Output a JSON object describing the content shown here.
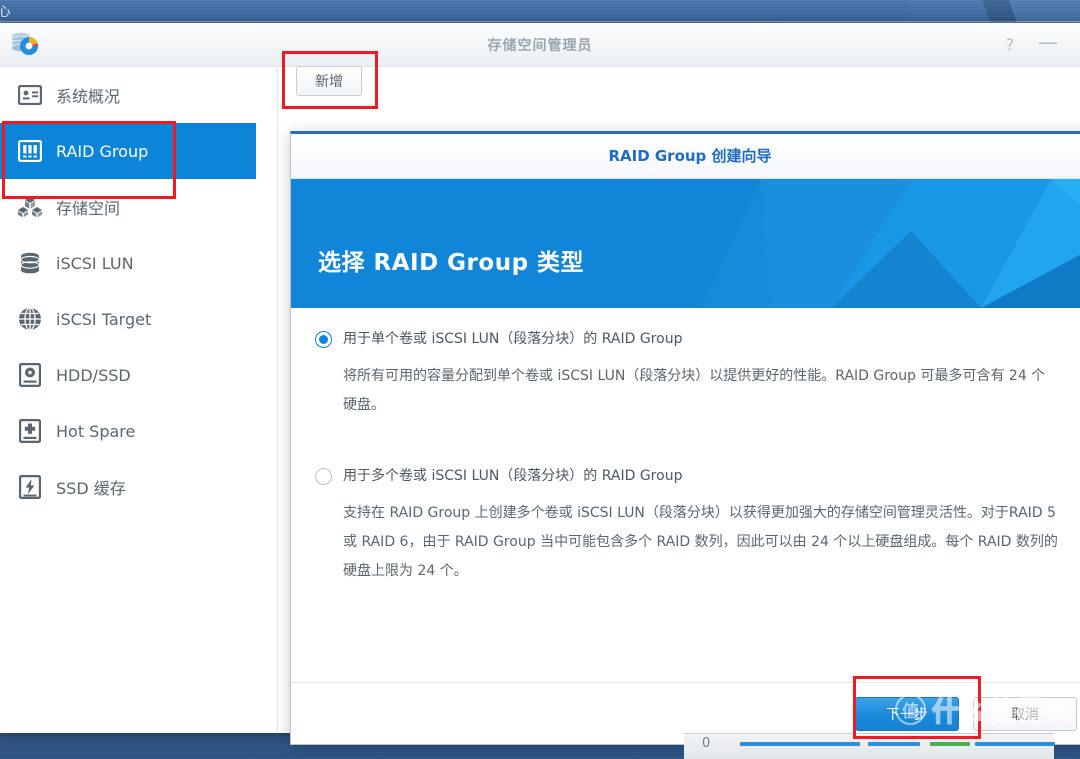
{
  "os": {
    "topbar_title": "中心",
    "taskbar_counter": "0"
  },
  "window": {
    "title": "存储空间管理员",
    "logo_icon": "storage-manager-icon",
    "controls": [
      {
        "name": "help-button",
        "glyph": "?"
      },
      {
        "name": "minimize-button",
        "glyph": "—"
      }
    ]
  },
  "toolbar": {
    "add_label": "新增"
  },
  "sidebar": {
    "items": [
      {
        "label": "系统概况",
        "icon": "system-overview-icon",
        "active": false
      },
      {
        "label": "RAID Group",
        "icon": "raid-group-icon",
        "active": true
      },
      {
        "label": "存储空间",
        "icon": "storage-pool-icon",
        "active": false
      },
      {
        "label": "iSCSI LUN",
        "icon": "iscsi-lun-icon",
        "active": false
      },
      {
        "label": "iSCSI Target",
        "icon": "iscsi-target-icon",
        "active": false
      },
      {
        "label": "HDD/SSD",
        "icon": "hdd-ssd-icon",
        "active": false
      },
      {
        "label": "Hot Spare",
        "icon": "hot-spare-icon",
        "active": false
      },
      {
        "label": "SSD 缓存",
        "icon": "ssd-cache-icon",
        "active": false
      }
    ]
  },
  "dialog": {
    "title": "RAID Group 创建向导",
    "banner_heading": "选择 RAID Group 类型",
    "options": [
      {
        "selected": true,
        "title": "用于单个卷或 iSCSI LUN（段落分块）的 RAID Group",
        "description": "将所有可用的容量分配到单个卷或 iSCSI LUN（段落分块）以提供更好的性能。RAID Group 可最多可含有 24 个硬盘。"
      },
      {
        "selected": false,
        "title": "用于多个卷或 iSCSI LUN（段落分块）的 RAID Group",
        "description": "支持在 RAID Group 上创建多个卷或 iSCSI LUN（段落分块）以获得更加强大的存储空间管理灵活性。对于RAID 5 或 RAID 6，由于 RAID Group 当中可能包含多个 RAID 数列，因此可以由 24 个以上硬盘组成。每个 RAID 数列的硬盘上限为 24 个。"
      }
    ],
    "buttons": {
      "next": "下一步",
      "cancel": "取消"
    }
  },
  "watermark": {
    "badge": "值",
    "text": "什么值得买"
  },
  "annotations": {
    "accent_red": "#ee1b22",
    "accent_blue": "#0c84d8",
    "boxes": [
      {
        "name": "highlight-sidebar-raid-group"
      },
      {
        "name": "highlight-add-button"
      },
      {
        "name": "highlight-next-button"
      }
    ]
  }
}
